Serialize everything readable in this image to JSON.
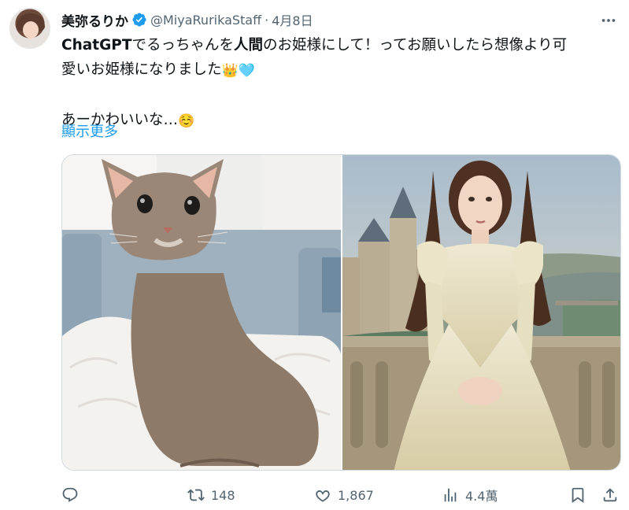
{
  "tweet": {
    "author": {
      "display_name": "美弥るりか",
      "handle": "@MiyaRurikaStaff",
      "verified": true,
      "verified_color": "#1d9bf0"
    },
    "separator": "·",
    "date": "4月8日",
    "text": {
      "line1_part1": "ChatGPT",
      "line1_part2": "でるっちゃんを",
      "line1_part3": "人間",
      "line1_part4": "のお姫様にして！ってお願いしたら想像より可",
      "line2": "愛いお姫様になりました",
      "line2_emoji_crown": "👑",
      "line2_emoji_heart": "🩵",
      "line3": "あーかわいいな…",
      "line3_emoji": "☺️"
    },
    "show_more": "顯示更多",
    "media": [
      {
        "subject": "cat-photo"
      },
      {
        "subject": "princess-painting"
      }
    ],
    "actions": {
      "reply_count": "",
      "retweet_count": "148",
      "like_count": "1,867",
      "views_count": "4.4萬"
    }
  },
  "colors": {
    "accent": "#1d9bf0",
    "text_primary": "#0f1419",
    "text_secondary": "#536471",
    "border": "#cfd9de"
  }
}
